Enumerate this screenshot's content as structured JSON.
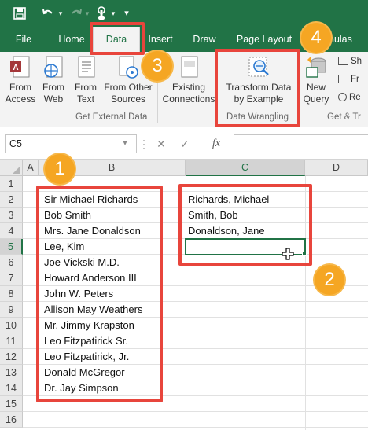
{
  "qat": {
    "save_icon": "save-icon",
    "undo_icon": "undo-icon",
    "redo_icon": "redo-icon",
    "touch_icon": "touch-mode-icon"
  },
  "tabs": [
    {
      "label": "File"
    },
    {
      "label": "Home"
    },
    {
      "label": "Data",
      "active": true
    },
    {
      "label": "Insert"
    },
    {
      "label": "Draw"
    },
    {
      "label": "Page Layout"
    },
    {
      "label": "nulas"
    }
  ],
  "ribbon": {
    "from_access": "From\nAccess",
    "from_web": "From\nWeb",
    "from_text": "From\nText",
    "from_other_sources": "From Other\nSources",
    "existing_connections": "Existing\nConnections",
    "transform_data": "Transform Data\nby Example",
    "new_query": "New\nQuery",
    "get_external_data": "Get External Data",
    "data_wrangling": "Data Wrangling",
    "get_transform": "Get & Tr",
    "mini_1": "Sh",
    "mini_2": "Fr",
    "mini_3": "Re"
  },
  "formula_bar": {
    "name_box": "C5",
    "fx": "fx"
  },
  "columns": [
    "A",
    "B",
    "C",
    "D"
  ],
  "rows": [
    "1",
    "2",
    "3",
    "4",
    "5",
    "6",
    "7",
    "8",
    "9",
    "10",
    "11",
    "12",
    "13",
    "14",
    "15",
    "16"
  ],
  "column_b": [
    "Sir Michael Richards",
    "Bob Smith",
    "Mrs. Jane Donaldson",
    "Lee, Kim",
    "Joe Vickski M.D.",
    "Howard Anderson III",
    "John W. Peters",
    "Allison May Weathers",
    "Mr. Jimmy Krapston",
    "Leo Fitzpatirick Sr.",
    "Leo Fitzpatirick, Jr.",
    "Donald McGregor",
    "Dr. Jay Simpson"
  ],
  "column_c": [
    "Richards, Michael",
    "Smith, Bob",
    "Donaldson, Jane"
  ],
  "badges": [
    "1",
    "2",
    "3",
    "4"
  ],
  "colors": {
    "excel_green": "#217346",
    "callout_red": "#e8453c",
    "badge_orange": "#f5a623"
  }
}
